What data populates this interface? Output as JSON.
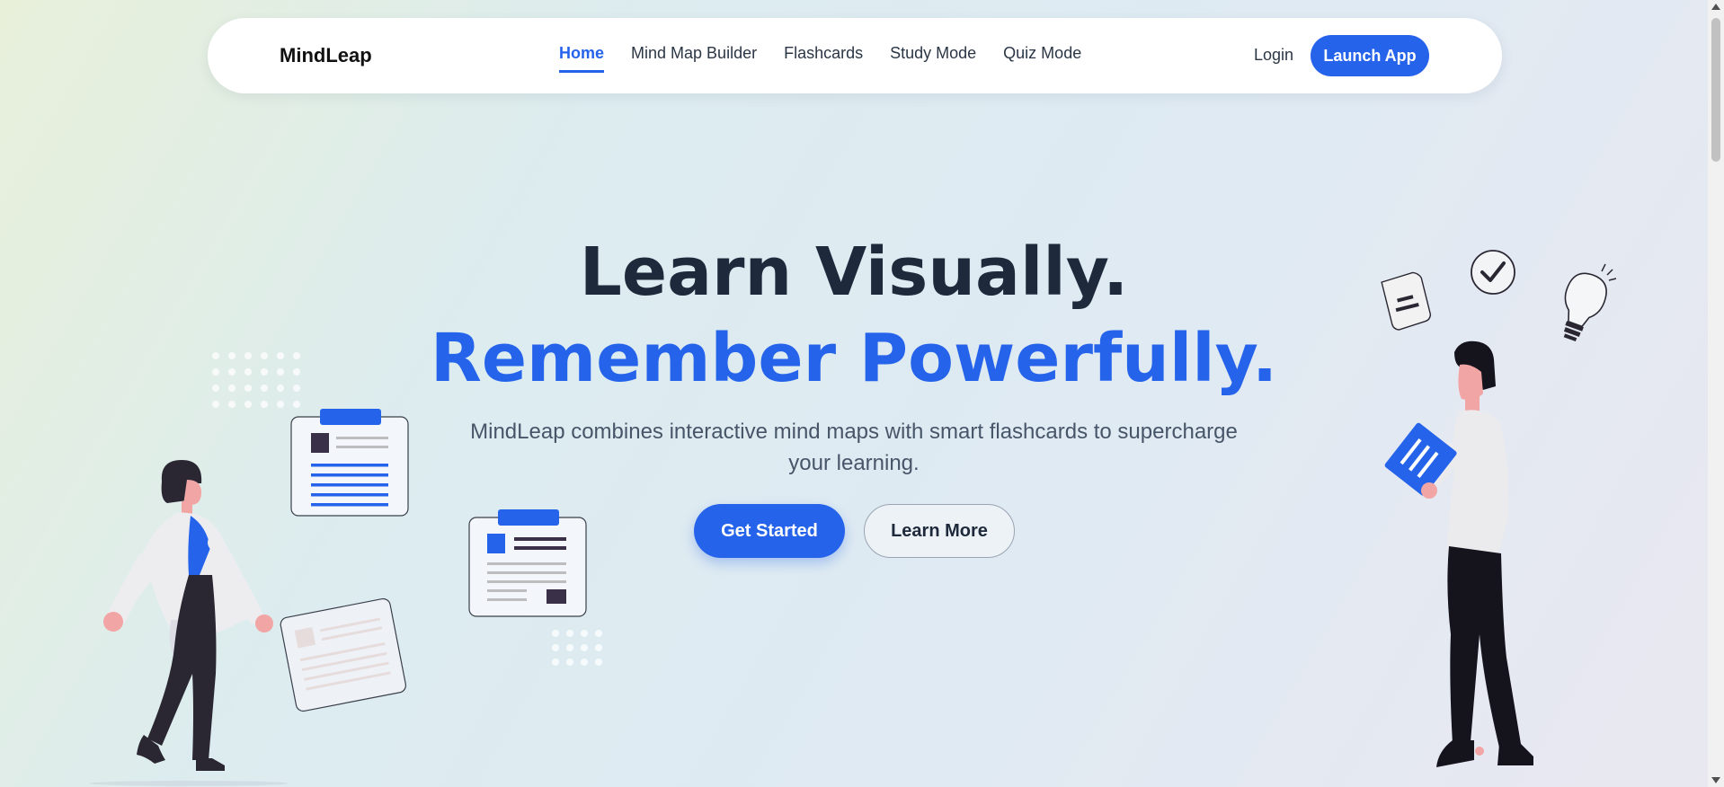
{
  "nav": {
    "brand": "MindLeap",
    "links": [
      {
        "label": "Home",
        "active": true
      },
      {
        "label": "Mind Map Builder",
        "active": false
      },
      {
        "label": "Flashcards",
        "active": false
      },
      {
        "label": "Study Mode",
        "active": false
      },
      {
        "label": "Quiz Mode",
        "active": false
      }
    ],
    "login": "Login",
    "launch": "Launch App"
  },
  "hero": {
    "title_line1": "Learn Visually.",
    "title_line2": "Remember Powerfully.",
    "subtitle": "MindLeap combines interactive mind maps with smart flashcards to supercharge your learning.",
    "primary_button": "Get Started",
    "secondary_button": "Learn More"
  },
  "colors": {
    "accent": "#2563eb",
    "heading": "#1e293b",
    "body_text": "#475569"
  },
  "icons": [
    "checkmark-icon",
    "lightbulb-icon",
    "note-icon"
  ]
}
